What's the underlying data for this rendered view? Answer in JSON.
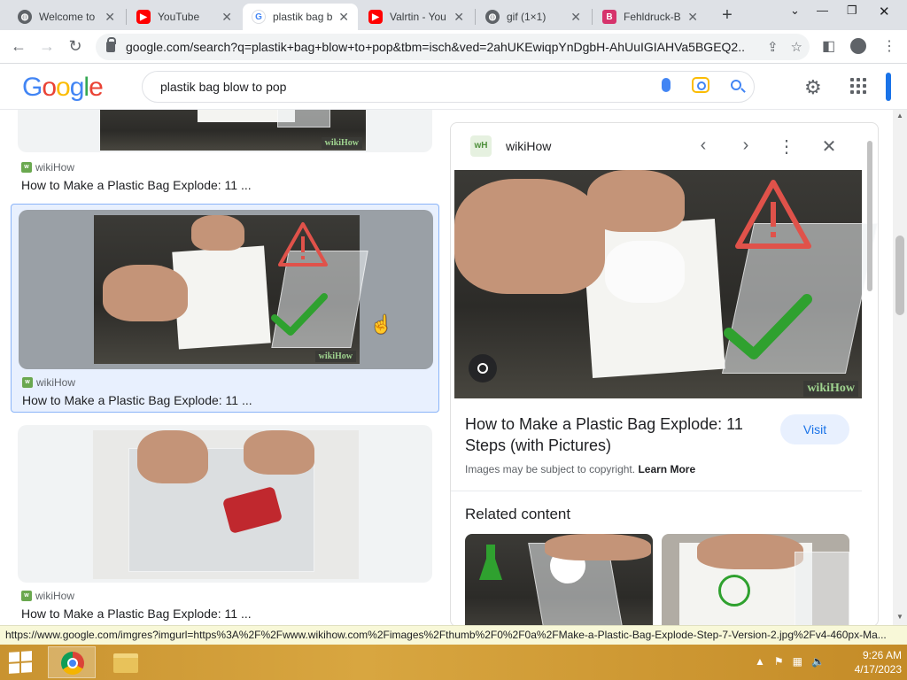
{
  "browser": {
    "tabs": [
      {
        "title": "Welcome to",
        "icon": "globe-icon"
      },
      {
        "title": "YouTube",
        "icon": "youtube-icon"
      },
      {
        "title": "plastik bag b",
        "icon": "google-icon"
      },
      {
        "title": "Valrtin - You",
        "icon": "youtube-icon"
      },
      {
        "title": "gif (1×1)",
        "icon": "globe-icon"
      },
      {
        "title": "Fehldruck-B",
        "icon": "bookmark-icon"
      }
    ],
    "url": "google.com/search?q=plastik+bag+blow+to+pop&tbm=isch&ved=2ahUKEwiqpYnDgbH-AhUuIGIAHVa5BGEQ2..."
  },
  "google": {
    "logo": "Google",
    "query": "plastik bag blow to pop"
  },
  "results": [
    {
      "source": "wikiHow",
      "title": "How to Make a Plastic Bag Explode: 11 ..."
    },
    {
      "source": "wikiHow",
      "title": "How to Make a Plastic Bag Explode: 11 ..."
    },
    {
      "source": "wikiHow",
      "title": "How to Make a Plastic Bag Explode: 11 ..."
    }
  ],
  "preview": {
    "source": "wikiHow",
    "source_icon_text": "wH",
    "watermark": "wikiHow",
    "title": "How to Make a Plastic Bag Explode: 11 Steps (with Pictures)",
    "visit_label": "Visit",
    "copyright": "Images may be subject to copyright.",
    "learn_more": "Learn More",
    "related_heading": "Related content"
  },
  "status_url": "https://www.google.com/imgres?imgurl=https%3A%2F%2Fwww.wikihow.com%2Fimages%2Fthumb%2F0%2F0a%2FMake-a-Plastic-Bag-Explode-Step-7-Version-2.jpg%2Fv4-460px-Ma...",
  "taskbar": {
    "time": "9:26 AM",
    "date": "4/17/2023"
  },
  "colors": {
    "accent": "#1a73e8",
    "youtube": "#ff0000",
    "check": "#2fa12f",
    "warning": "#e0524a"
  }
}
